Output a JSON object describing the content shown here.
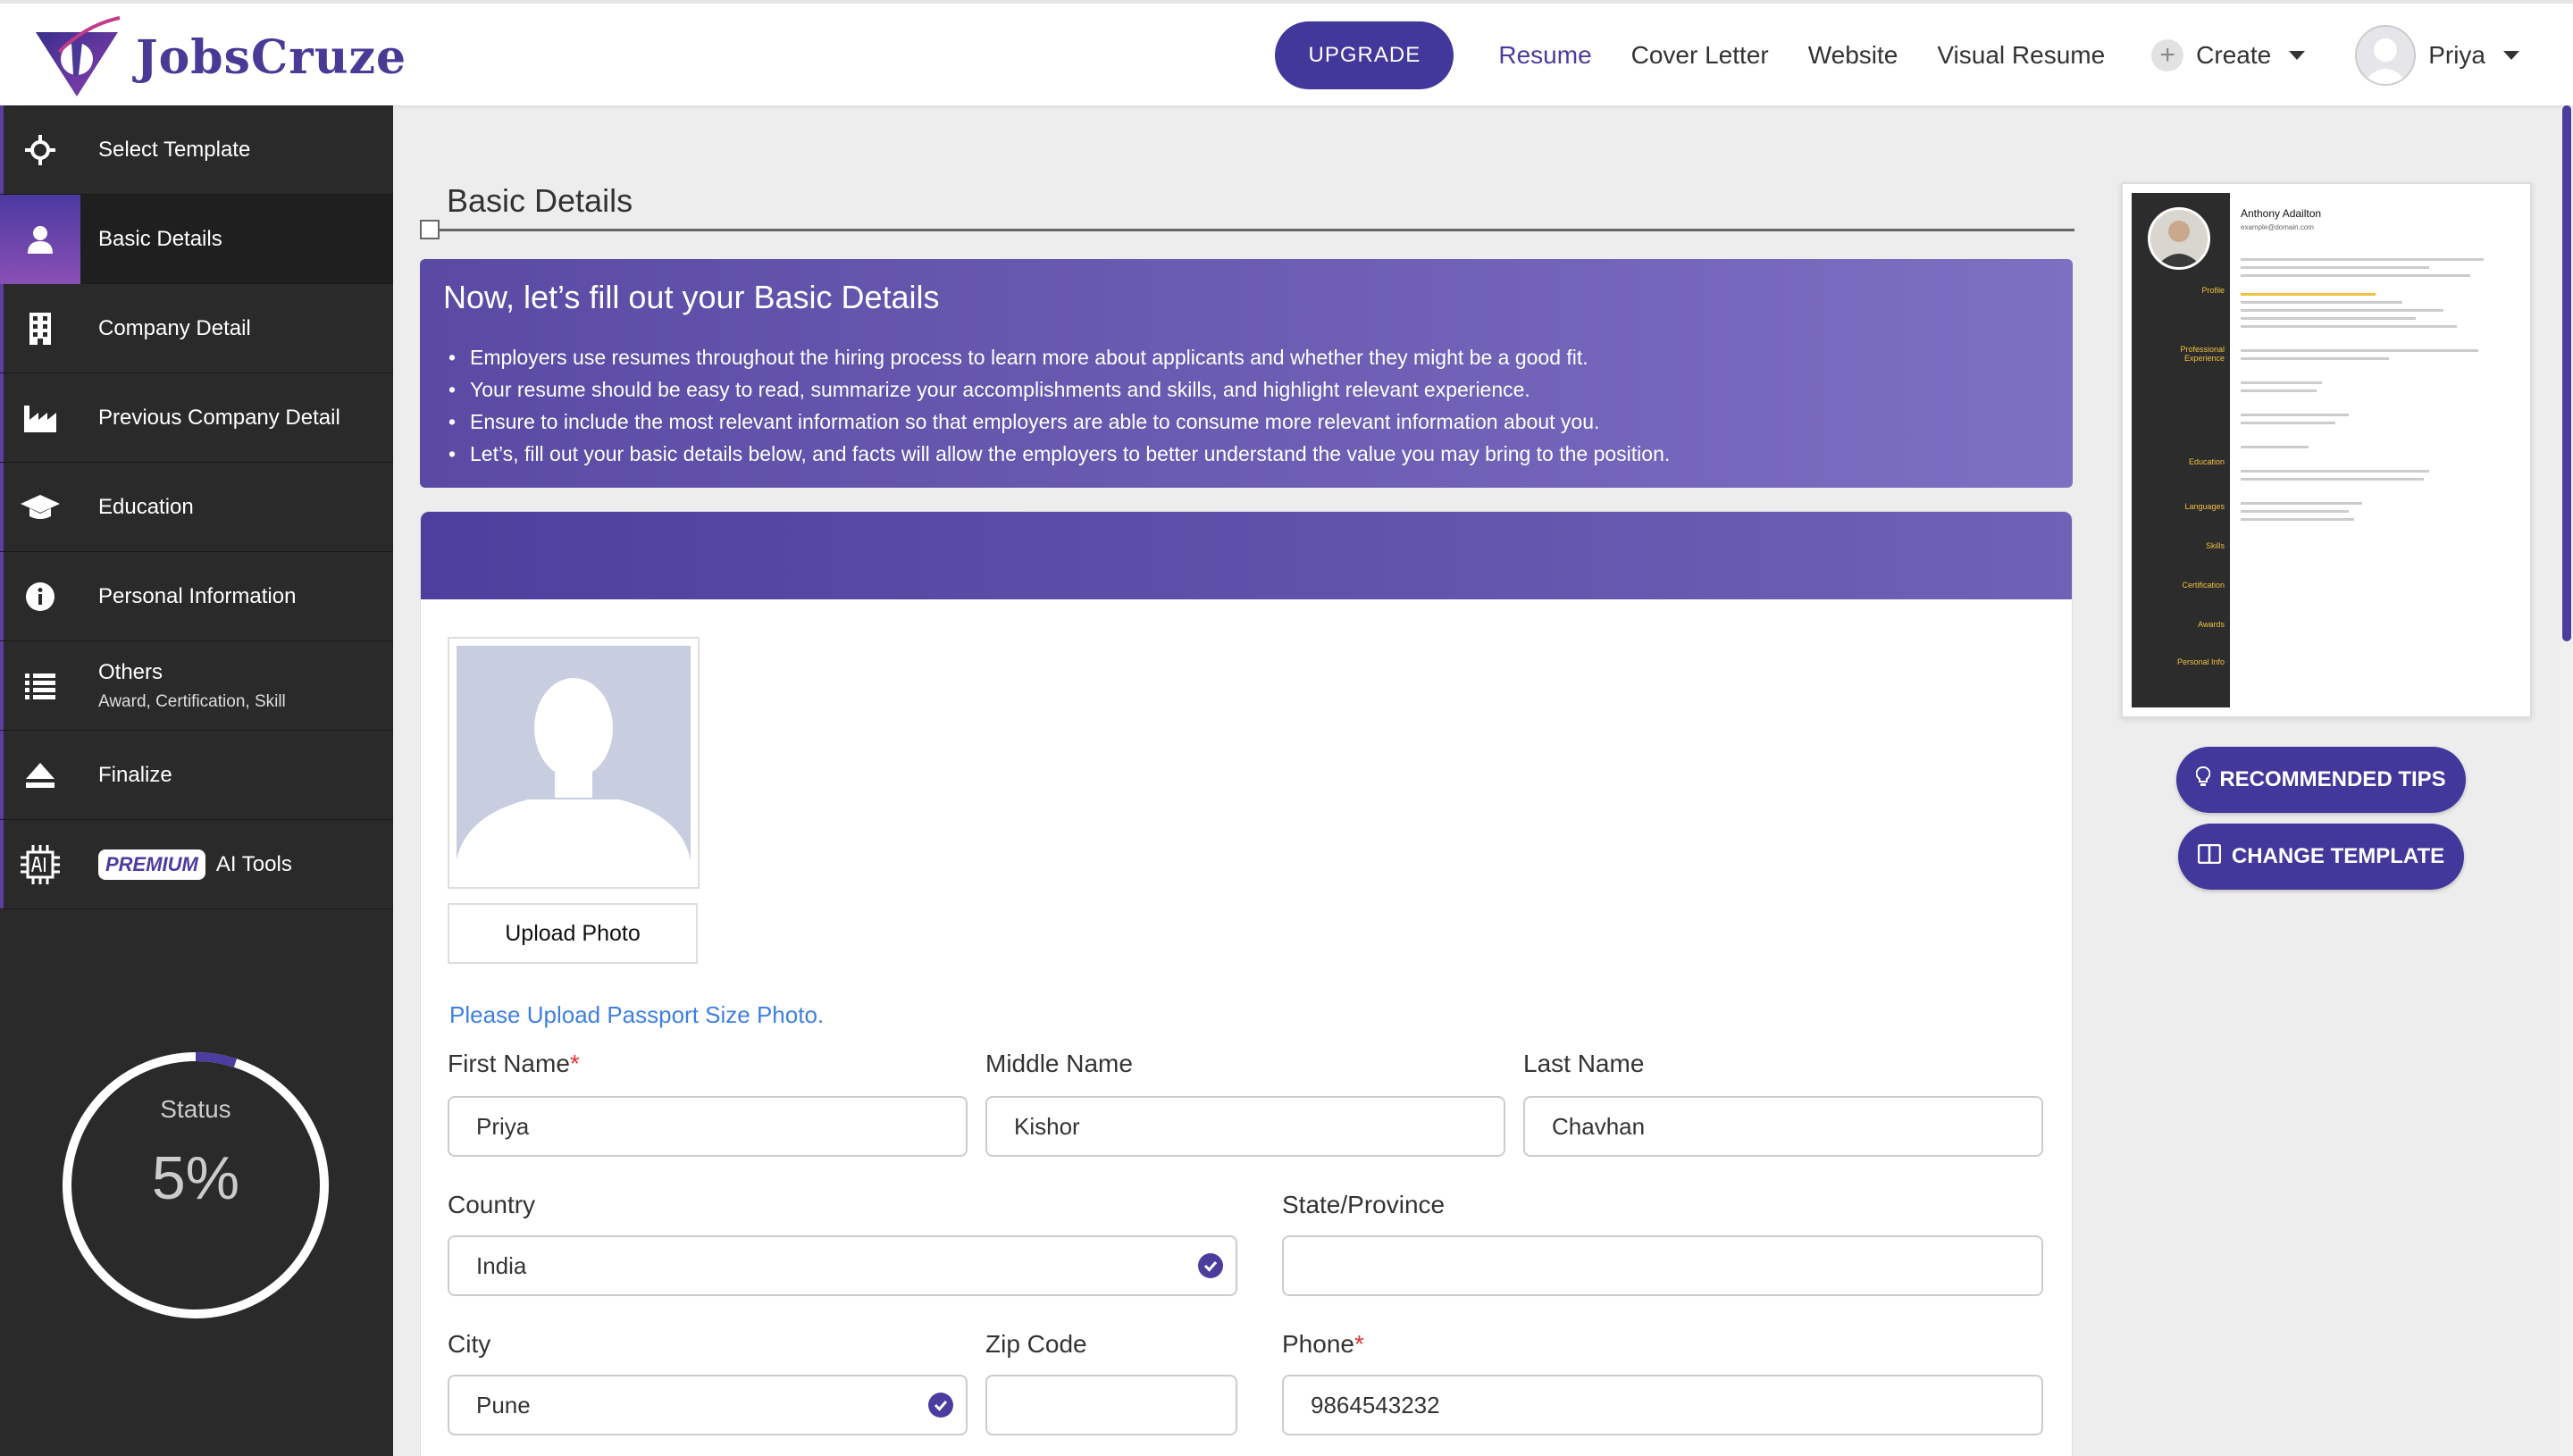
{
  "brand": {
    "name": "JobsCruze",
    "accent": "#42379a"
  },
  "header": {
    "upgrade_label": "UPGRADE",
    "nav": [
      "Resume",
      "Cover Letter",
      "Website",
      "Visual Resume"
    ],
    "create_label": "Create",
    "user_name": "Priya"
  },
  "sidebar": {
    "items": [
      {
        "label": "Select Template",
        "icon": "crosshair-icon"
      },
      {
        "label": "Basic Details",
        "icon": "user-icon",
        "active": true
      },
      {
        "label": "Company Detail",
        "icon": "building-icon"
      },
      {
        "label": "Previous Company Detail",
        "icon": "factory-icon"
      },
      {
        "label": "Education",
        "icon": "graduation-cap-icon"
      },
      {
        "label": "Personal Information",
        "icon": "info-icon"
      },
      {
        "label": "Others",
        "icon": "list-icon",
        "sub": "Award,  Certification,  Skill"
      },
      {
        "label": "Finalize",
        "icon": "eject-icon"
      },
      {
        "label": "AI Tools",
        "icon": "chip-icon",
        "badge": "PREMIUM"
      }
    ],
    "status_label": "Status",
    "status_value": "5%",
    "status_fraction": 0.05
  },
  "main": {
    "section_title": "Basic Details",
    "banner": {
      "heading": "Now, let’s fill out your Basic Details",
      "bullets": [
        "Employers use resumes throughout the hiring process to learn more about applicants and whether they might be a good fit.",
        "Your resume should be easy to read, summarize your accomplishments and skills, and highlight relevant experience.",
        "Ensure to include the most relevant information so that employers are able to consume more relevant information about you.",
        "Let’s, fill out your basic details below, and facts will allow the employers to better understand the value you may bring to the position."
      ]
    },
    "upload_photo_label": "Upload Photo",
    "photo_hint": "Please Upload Passport Size Photo.",
    "fields": {
      "first_name": {
        "label": "First Name",
        "value": "Priya",
        "required": "*"
      },
      "middle_name": {
        "label": "Middle Name",
        "value": "Kishor"
      },
      "last_name": {
        "label": "Last Name",
        "value": "Chavhan"
      },
      "country": {
        "label": "Country",
        "value": "India"
      },
      "state": {
        "label": "State/Province",
        "value": ""
      },
      "city": {
        "label": "City",
        "value": "Pune"
      },
      "zip": {
        "label": "Zip Code",
        "value": ""
      },
      "phone": {
        "label": "Phone",
        "value": "9864543232",
        "required": "*"
      }
    }
  },
  "preview": {
    "name": "Anthony Adailton",
    "email": "example@domain.com",
    "side_labels": [
      "Profile",
      "Professional Experience",
      "Education",
      "Languages",
      "Skills",
      "Certification",
      "Awards",
      "Personal Info"
    ]
  },
  "right_buttons": {
    "tips": "RECOMMENDED TIPS",
    "change_template": "CHANGE TEMPLATE"
  }
}
